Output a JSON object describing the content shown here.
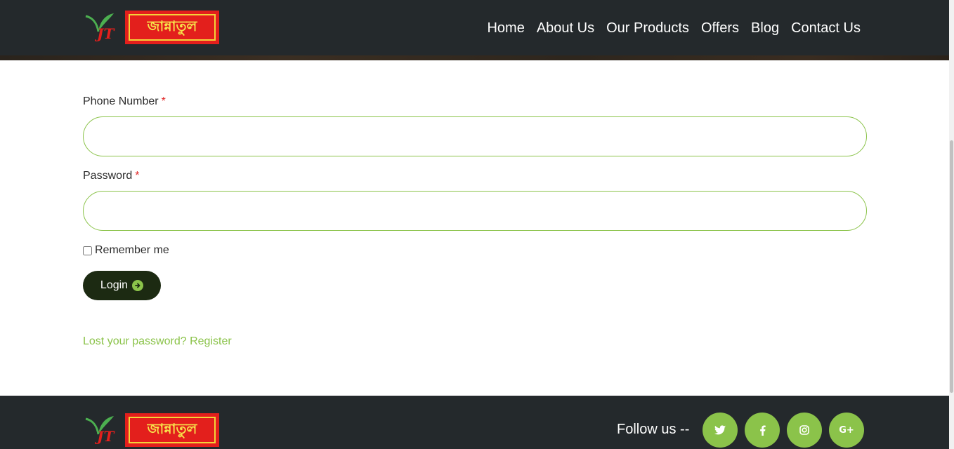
{
  "brand": {
    "logo_text": "জান্নাতুল",
    "logo_mark": "JT",
    "colors": {
      "red": "#e31f1c",
      "yellow": "#f7e24a",
      "green": "#4caf50"
    }
  },
  "nav": {
    "items": [
      {
        "label": "Home"
      },
      {
        "label": "About Us"
      },
      {
        "label": "Our Products"
      },
      {
        "label": "Offers"
      },
      {
        "label": "Blog"
      },
      {
        "label": "Contact Us"
      }
    ]
  },
  "form": {
    "phone_label": "Phone Number",
    "password_label": "Password",
    "required_mark": "*",
    "phone_value": "",
    "password_value": "",
    "remember_label": "Remember me",
    "remember_checked": false,
    "login_label": "Login",
    "login_icon": "arrow-circle-right-icon",
    "lost_password_link": "Lost your password?",
    "register_link": "Register"
  },
  "footer": {
    "follow_label": "Follow us --",
    "social": [
      {
        "icon": "twitter-icon",
        "glyph": "🐦"
      },
      {
        "icon": "facebook-icon",
        "glyph": "f"
      },
      {
        "icon": "instagram-icon",
        "glyph": "◎"
      },
      {
        "icon": "google-plus-icon",
        "glyph": "G+"
      }
    ]
  },
  "colors": {
    "header_bg": "#24292c",
    "accent_green": "#8bc34a",
    "button_dark": "#1c2a12",
    "required_red": "#e02424"
  }
}
